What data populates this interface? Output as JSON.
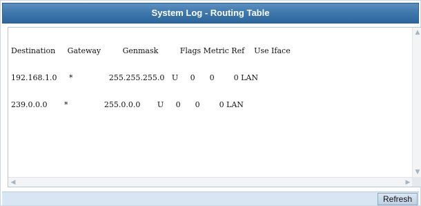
{
  "window": {
    "title": "System Log - Routing Table"
  },
  "log": {
    "header": "Destination     Gateway         Genmask         Flags Metric Ref    Use Iface",
    "rows": [
      "192.168.1.0     *               255.255.255.0   U     0      0        0 LAN",
      "239.0.0.0       *               255.0.0.0       U     0      0        0 LAN"
    ]
  },
  "footer": {
    "refresh_label": "Refresh"
  },
  "icons": {
    "scroll_up": "chevron-up-icon",
    "scroll_down": "chevron-down-icon",
    "scroll_left": "chevron-left-icon",
    "scroll_right": "chevron-right-icon"
  },
  "colors": {
    "title_bar": "#3f78ad",
    "footer": "#d8e6f3"
  }
}
